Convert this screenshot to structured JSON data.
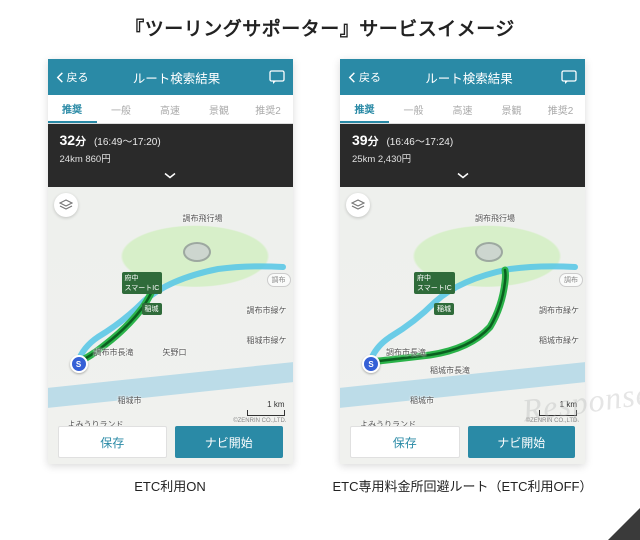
{
  "title": "『ツーリングサポーター』サービスイメージ",
  "watermark": "Response.",
  "tabs": [
    "推奨",
    "一般",
    "高速",
    "景観",
    "推奨2"
  ],
  "topbar": {
    "back": "戻る",
    "title": "ルート検索結果"
  },
  "map_common": {
    "scale": "1 km",
    "copyright": "©ZENRIN CO.,LTD.",
    "labels": {
      "chofu_airfield": "調布飛行場",
      "fuchu_ic": "府中\nスマートIC",
      "inagi": "稲城",
      "chofu": "調布",
      "chofu_green": "調布市緑ケ",
      "inagi_green": "稲城市緑ケ",
      "inagi_city": "稲城市",
      "yomiuri": "よみうりランド",
      "yano": "矢野口",
      "chofu_nagare": "調布市長滝",
      "inagi_nagare": "稲城市長滝"
    }
  },
  "buttons": {
    "save": "保存",
    "start": "ナビ開始"
  },
  "phones": [
    {
      "duration": "32",
      "unit": "分",
      "range": "(16:49～17:20)",
      "distance": "24km  860円",
      "caption": "ETC利用ON"
    },
    {
      "duration": "39",
      "unit": "分",
      "range": "(16:46～17:24)",
      "distance": "25km  2,430円",
      "caption": "ETC専用料金所回避ルート（ETC利用OFF）"
    }
  ]
}
